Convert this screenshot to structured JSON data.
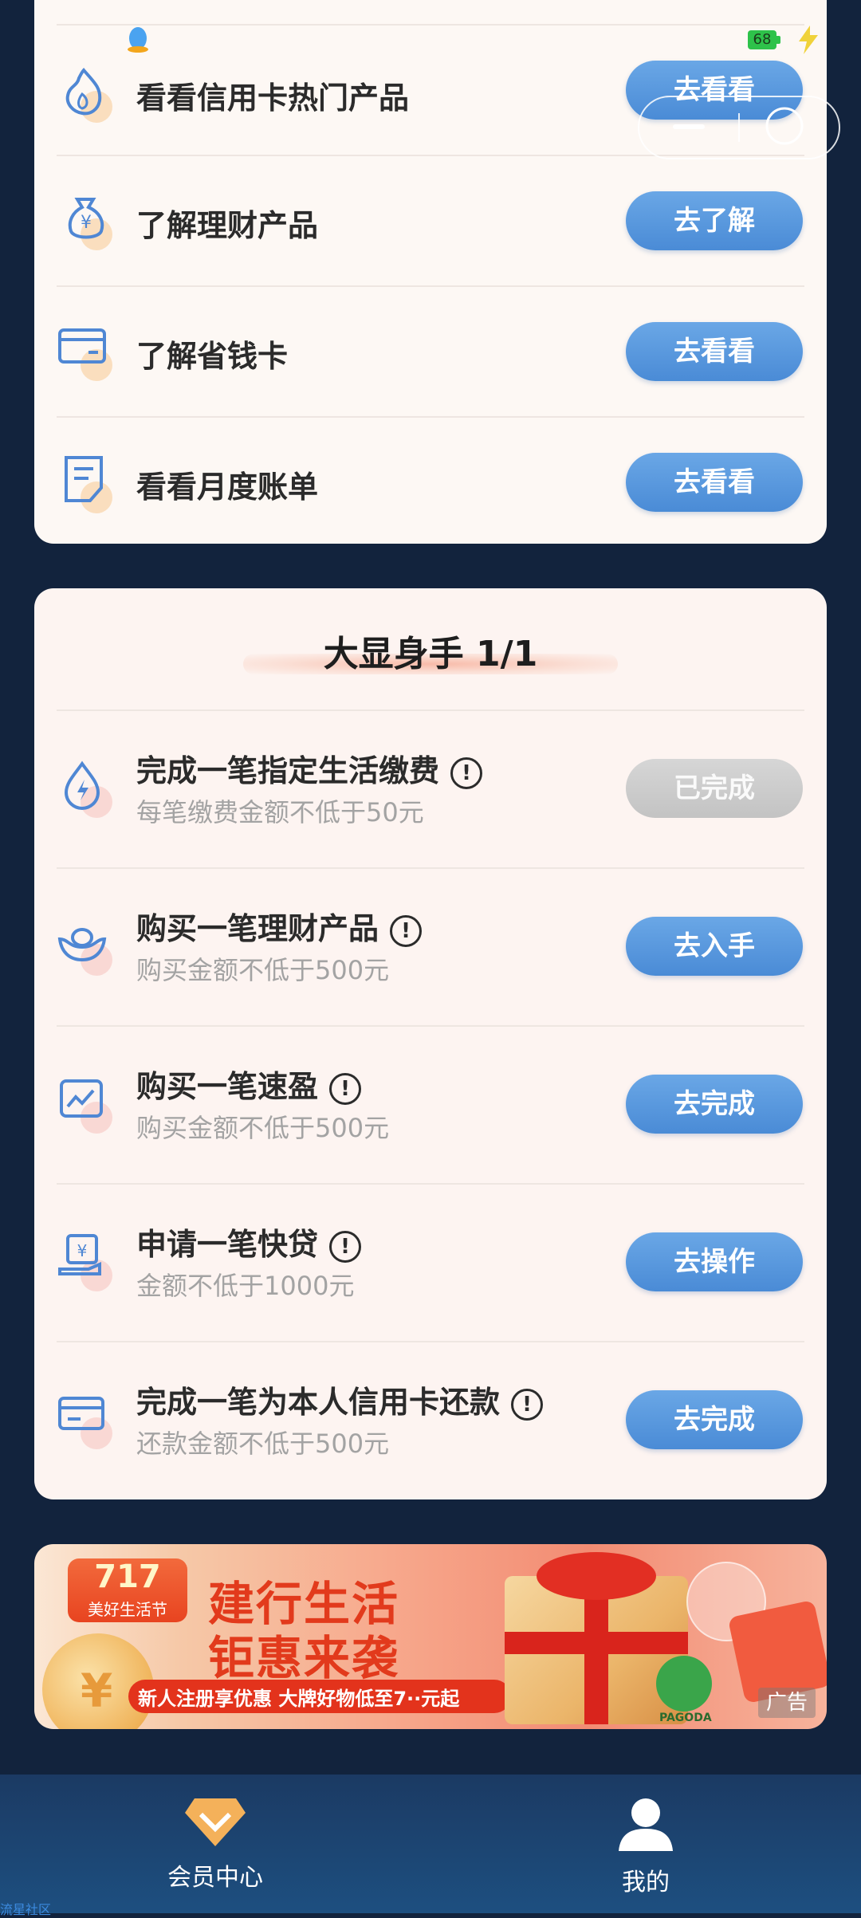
{
  "status_bar": {
    "battery": "68"
  },
  "daily_tasks": {
    "items": [
      {
        "title": "看看信用卡热门产品",
        "button": "去看看",
        "icon": "flame-icon"
      },
      {
        "title": "了解理财产品",
        "button": "去了解",
        "icon": "money-bag-icon"
      },
      {
        "title": "了解省钱卡",
        "button": "去看看",
        "icon": "card-icon"
      },
      {
        "title": "看看月度账单",
        "button": "去看看",
        "icon": "bill-icon"
      }
    ]
  },
  "challenge": {
    "title": "大显身手 1/1",
    "items": [
      {
        "title": "完成一笔指定生活缴费",
        "subtitle": "每笔缴费金额不低于50元",
        "button": "已完成",
        "done": true,
        "icon": "utility-drop-icon"
      },
      {
        "title": "购买一笔理财产品",
        "subtitle": "购买金额不低于500元",
        "button": "去入手",
        "done": false,
        "icon": "gold-ingot-icon"
      },
      {
        "title": "购买一笔速盈",
        "subtitle": "购买金额不低于500元",
        "button": "去完成",
        "done": false,
        "icon": "trend-chart-icon"
      },
      {
        "title": "申请一笔快贷",
        "subtitle": "金额不低于1000元",
        "button": "去操作",
        "done": false,
        "icon": "loan-hand-icon"
      },
      {
        "title": "完成一笔为本人信用卡还款",
        "subtitle": "还款金额不低于500元",
        "button": "去完成",
        "done": false,
        "icon": "card-repay-icon"
      }
    ]
  },
  "banner": {
    "badge_number": "717",
    "badge_text": "美好生活节",
    "headline_line1": "建行生活",
    "headline_line2": "钜惠来袭",
    "strip_text": "新人注册享优惠 大牌好物低至7··元起",
    "brand": "PAGODA",
    "ad_label": "广告"
  },
  "tabbar": {
    "tabs": [
      {
        "label": "会员中心",
        "icon": "diamond-icon"
      },
      {
        "label": "我的",
        "icon": "user-icon"
      }
    ]
  },
  "watermark": "流星社区",
  "colors": {
    "accent_button": "#4a8bd6",
    "done_button": "#c3c3c3",
    "background": "#12233d"
  }
}
